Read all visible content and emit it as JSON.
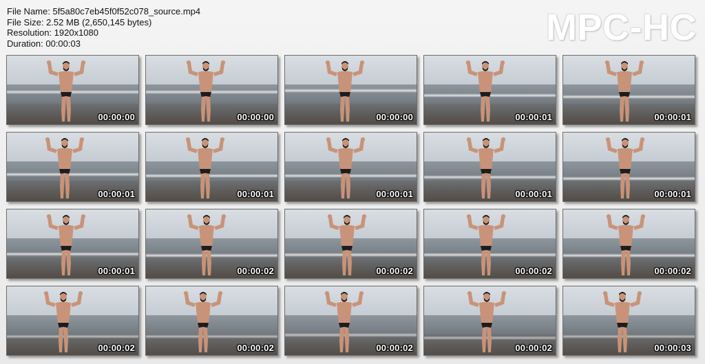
{
  "info": {
    "file_name": "File Name: 5f5a80c7eb45f0f52c078_source.mp4",
    "file_size": "File Size: 2.52 MB (2,650,145 bytes)",
    "resolution": "Resolution: 1920x1080",
    "duration": "Duration: 00:00:03"
  },
  "logo": "MPC-HC",
  "colors": {
    "skin": "#c89378",
    "trunks": "#1d1c1f",
    "hair": "#1a1614"
  },
  "thumbnails": [
    {
      "time": "00:00:00"
    },
    {
      "time": "00:00:00"
    },
    {
      "time": "00:00:00"
    },
    {
      "time": "00:00:01"
    },
    {
      "time": "00:00:01"
    },
    {
      "time": "00:00:01"
    },
    {
      "time": "00:00:01"
    },
    {
      "time": "00:00:01"
    },
    {
      "time": "00:00:01"
    },
    {
      "time": "00:00:01"
    },
    {
      "time": "00:00:01"
    },
    {
      "time": "00:00:02"
    },
    {
      "time": "00:00:02"
    },
    {
      "time": "00:00:02"
    },
    {
      "time": "00:00:02"
    },
    {
      "time": "00:00:02"
    },
    {
      "time": "00:00:02"
    },
    {
      "time": "00:00:02"
    },
    {
      "time": "00:00:02"
    },
    {
      "time": "00:00:03"
    }
  ]
}
